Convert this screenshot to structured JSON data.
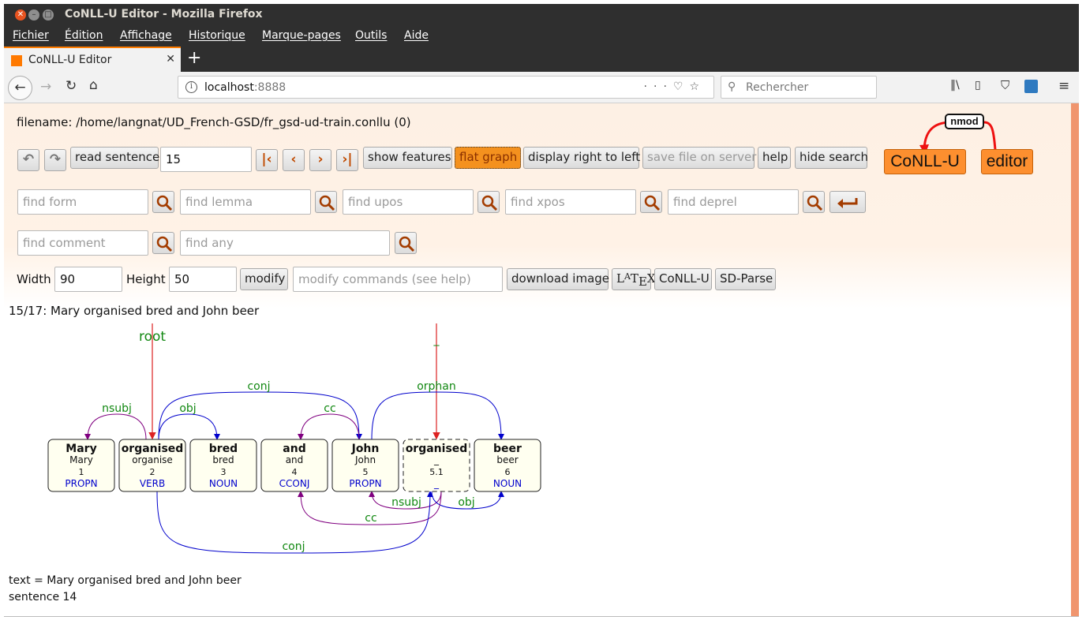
{
  "window": {
    "title": "CoNLL-U Editor - Mozilla Firefox"
  },
  "menu": [
    "Fichier",
    "Édition",
    "Affichage",
    "Historique",
    "Marque-pages",
    "Outils",
    "Aide"
  ],
  "tab": {
    "title": "CoNLL-U Editor"
  },
  "url": {
    "host": "localhost",
    "port": ":8888"
  },
  "search": {
    "placeholder": "Rechercher"
  },
  "page": {
    "filename": "filename: /home/langnat/UD_French-GSD/fr_gsd-ud-train.conllu (0)",
    "toolbar": {
      "read_sentence": "read sentence",
      "sentence_number": "15",
      "show_features": "show features",
      "flat_graph": "flat graph",
      "display_rtl": "display right to left",
      "save_file": "save file on server",
      "help": "help",
      "hide_search": "hide search"
    },
    "search_fields": {
      "form": "find form",
      "lemma": "find lemma",
      "upos": "find upos",
      "xpos": "find xpos",
      "deprel": "find deprel",
      "comment": "find comment",
      "any": "find any"
    },
    "size": {
      "width_label": "Width",
      "width_value": "90",
      "height_label": "Height",
      "height_value": "50",
      "modify": "modify",
      "modify_placeholder": "modify commands (see help)",
      "download": "download image",
      "latex_L": "L",
      "latex_A": "A",
      "latex_T": "T",
      "latex_E": "E",
      "latex_X": "X",
      "conllu": "CoNLL-U",
      "sdparse": "SD-Parse"
    },
    "logo": {
      "left": "CoNLL-U",
      "right": "editor",
      "arc": "nmod"
    },
    "sentence_header": "15/17: Mary organised bred and John beer",
    "footer": {
      "text": "text = Mary organised bred and John beer",
      "sentence": "sentence 14"
    }
  },
  "graph": {
    "tokens": [
      {
        "form": "Mary",
        "lemma": "Mary",
        "id": "1",
        "upos": "PROPN"
      },
      {
        "form": "organised",
        "lemma": "organise",
        "id": "2",
        "upos": "VERB"
      },
      {
        "form": "bred",
        "lemma": "bred",
        "id": "3",
        "upos": "NOUN"
      },
      {
        "form": "and",
        "lemma": "and",
        "id": "4",
        "upos": "CCONJ"
      },
      {
        "form": "John",
        "lemma": "John",
        "id": "5",
        "upos": "PROPN"
      },
      {
        "form": "organised",
        "lemma": "_",
        "id": "5.1",
        "upos": "_",
        "empty": true
      },
      {
        "form": "beer",
        "lemma": "beer",
        "id": "6",
        "upos": "NOUN"
      }
    ],
    "roots": [
      {
        "label": "root",
        "token": 1
      },
      {
        "label": "_",
        "token": 5
      }
    ],
    "arcs_above": [
      {
        "label": "nsubj",
        "head": 1,
        "dep": 0,
        "color": "#800080"
      },
      {
        "label": "obj",
        "head": 1,
        "dep": 2,
        "color": "#0000cc"
      },
      {
        "label": "conj",
        "head": 1,
        "dep": 4,
        "color": "#0000cc"
      },
      {
        "label": "cc",
        "head": 4,
        "dep": 3,
        "color": "#800080"
      },
      {
        "label": "orphan",
        "head": 4,
        "dep": 6,
        "color": "#0000cc"
      }
    ],
    "arcs_below": [
      {
        "label": "nsubj",
        "head": 5,
        "dep": 4,
        "color": "#800080"
      },
      {
        "label": "obj",
        "head": 5,
        "dep": 6,
        "color": "#0000cc"
      },
      {
        "label": "cc",
        "head": 5,
        "dep": 3,
        "color": "#800080"
      },
      {
        "label": "conj",
        "head": 1,
        "dep": 5,
        "color": "#0000cc"
      }
    ]
  }
}
